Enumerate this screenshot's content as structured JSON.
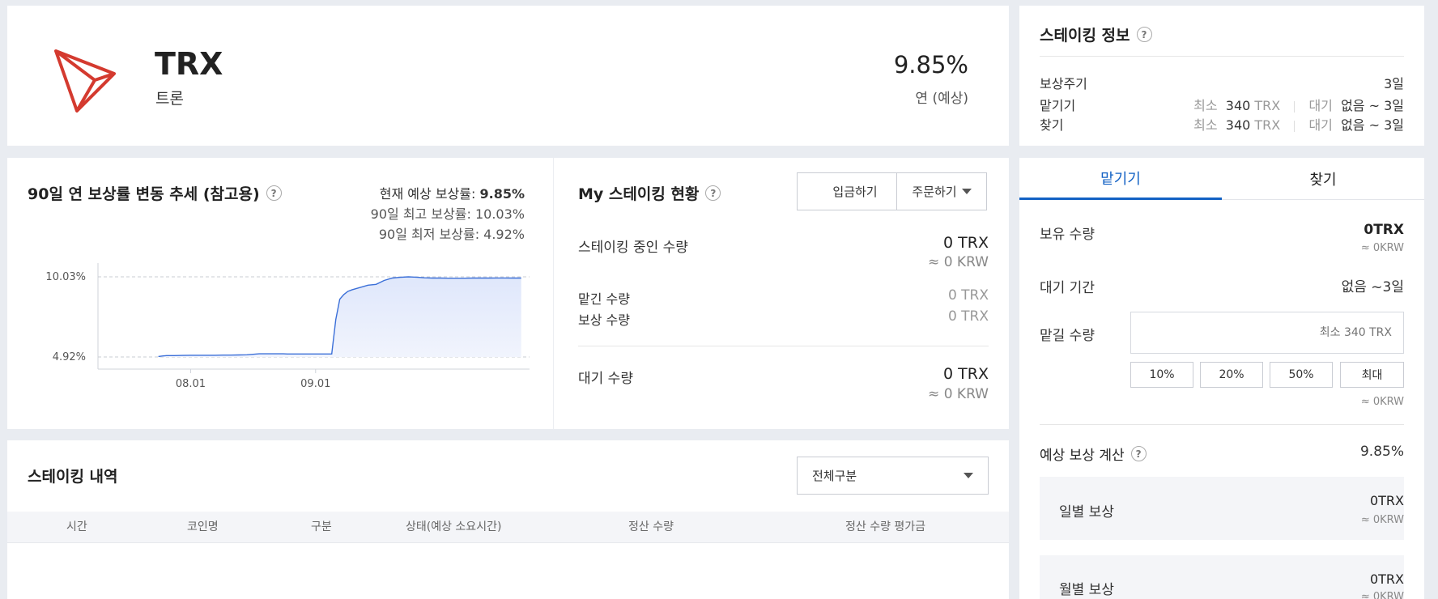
{
  "coin": {
    "symbol": "TRX",
    "name": "트론",
    "rate": "9.85%",
    "rate_label": "연 (예상)"
  },
  "info": {
    "title": "스테이킹 정보",
    "cycle_label": "보상주기",
    "cycle_value": "3일",
    "stake_label": "맡기기",
    "unstake_label": "찾기",
    "min_label": "최소",
    "min_amount": "340",
    "min_unit": "TRX",
    "wait_label": "대기",
    "wait_value": "없음 ~ 3일"
  },
  "trend": {
    "title": "90일 연 보상률 변동 추세 (참고용)",
    "current_label": "현재 예상 보상률: ",
    "current_value": "9.85%",
    "max_text": "90일 최고 보상률: 10.03%",
    "min_text": "90일 최저 보상률: 4.92%"
  },
  "chart_data": {
    "type": "area",
    "title": "",
    "xlabel": "",
    "ylabel": "",
    "ylim": [
      4.92,
      10.03
    ],
    "yticks": [
      "10.03%",
      "4.92%"
    ],
    "xticks": [
      "08.01",
      "09.01"
    ],
    "grid": "horizontal dashed at y ticks",
    "series": [
      {
        "x": [
          0,
          1,
          2,
          4,
          6,
          8,
          10,
          12,
          14,
          16,
          18,
          20,
          22,
          25,
          28,
          30,
          31,
          32,
          33,
          34,
          35,
          36,
          37,
          38,
          39,
          40,
          41,
          42,
          43,
          44,
          45,
          46,
          47,
          48,
          50,
          52,
          54,
          56,
          58,
          60,
          62,
          64,
          66,
          68,
          70,
          72,
          74,
          76,
          78,
          80,
          82,
          84,
          86,
          88,
          90
        ],
        "y": [
          4.95,
          4.98,
          5.01,
          5.01,
          5.02,
          5.03,
          5.03,
          5.03,
          5.03,
          5.04,
          5.04,
          5.05,
          5.06,
          5.12,
          5.12,
          5.12,
          5.12,
          5.11,
          5.11,
          5.11,
          5.11,
          5.11,
          5.11,
          5.11,
          5.11,
          5.11,
          5.11,
          5.11,
          5.11,
          7.3,
          8.6,
          8.9,
          9.1,
          9.2,
          9.35,
          9.5,
          9.55,
          9.8,
          9.95,
          10.0,
          10.03,
          10.01,
          9.97,
          9.95,
          9.95,
          9.94,
          9.94,
          9.94,
          9.95,
          9.95,
          9.95,
          9.96,
          9.96,
          9.95,
          9.95
        ]
      }
    ]
  },
  "my": {
    "title": "My 스테이킹 현황",
    "deposit_btn": "입금하기",
    "order_btn": "주문하기",
    "staking_label": "스테이킹 중인 수량",
    "staking_amount": "0 TRX",
    "staking_krw": "≈ 0 KRW",
    "staked_label": "맡긴 수량",
    "staked_value": "0 TRX",
    "reward_label": "보상 수량",
    "reward_value": "0 TRX",
    "pending_label": "대기 수량",
    "pending_amount": "0 TRX",
    "pending_krw": "≈ 0 KRW"
  },
  "history": {
    "title": "스테이킹 내역",
    "filter": "전체구분",
    "columns": [
      "시간",
      "코인명",
      "구분",
      "상태(예상 소요시간)",
      "정산 수량",
      "정산 수량 평가금"
    ]
  },
  "form": {
    "tab_stake": "맡기기",
    "tab_unstake": "찾기",
    "holding_label": "보유 수량",
    "holding_value": "0TRX",
    "holding_krw": "≈ 0KRW",
    "wait_label": "대기 기간",
    "wait_value": "없음 ~3일",
    "amount_label": "맡길 수량",
    "amount_placeholder": "최소 340 TRX",
    "pct": [
      "10%",
      "20%",
      "50%",
      "최대"
    ],
    "amount_krw": "≈ 0KRW",
    "calc_label": "예상 보상 계산",
    "calc_rate": "9.85%",
    "daily_label": "일별 보상",
    "daily_value": "0TRX",
    "daily_krw": "≈ 0KRW",
    "monthly_label": "월별 보상",
    "monthly_value": "0TRX",
    "monthly_krw": "≈ 0KRW"
  },
  "colors": {
    "accent": "#1261c4",
    "logo": "#d43a2f",
    "chart_line": "#3b6fd8",
    "chart_fill": "#dfe7fb"
  }
}
